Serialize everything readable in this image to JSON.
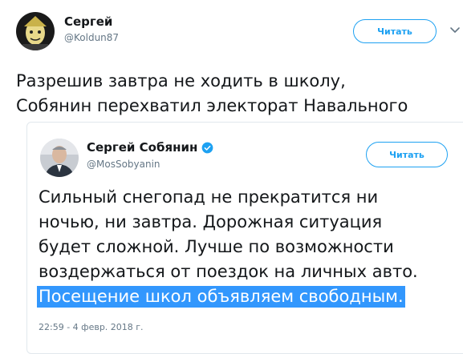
{
  "tweet": {
    "author_name": "Сергей",
    "author_handle": "@Koldun87",
    "follow_label": "Читать",
    "text_lines": [
      "Разрешив завтра не ходить в школу,",
      "Собянин перехватил электорат Навального"
    ]
  },
  "quoted_tweet": {
    "author_name": "Сергей Собянин",
    "author_handle": "@MosSobyanin",
    "follow_label": "Читать",
    "text_lines": [
      "Сильный снегопад не прекратится ни",
      "ночью, ни завтра. Дорожная ситуация",
      "будет сложной. Лучше по возможности",
      "воздержаться от поездок на личных авто."
    ],
    "highlighted_line": "Посещение школ объявляем свободным.",
    "timestamp": "22:59 - 4 февр. 2018 г."
  },
  "colors": {
    "accent": "#1da1f2",
    "highlight": "#3297fd",
    "secondary_text": "#657786",
    "border": "#e1e8ed"
  },
  "icons": {
    "outer_avatar": "avatar-portrait",
    "verified": "verified-badge-icon",
    "menu": "chevron-down-icon"
  }
}
